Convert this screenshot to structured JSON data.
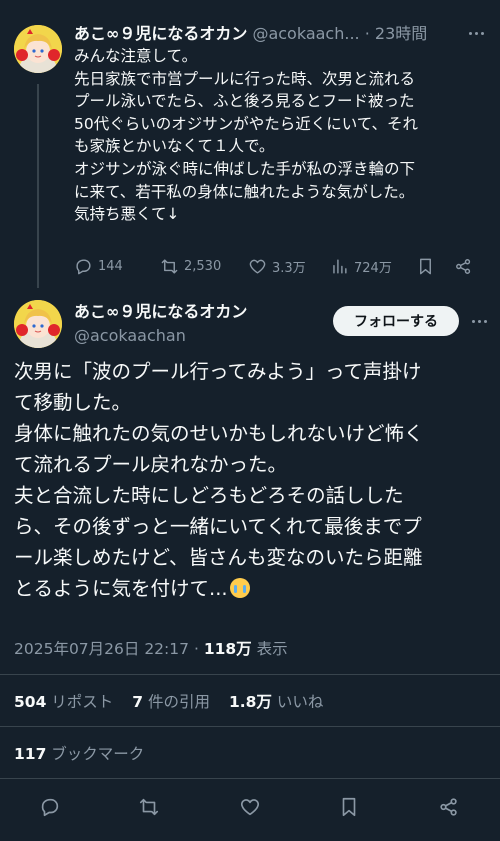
{
  "tweet1": {
    "name": "あこ∞９児になるオカン",
    "handle": "@acokaach...",
    "separator": "·",
    "time": "23時間",
    "lines": [
      "みんな注意して。",
      "先日家族で市営プールに行った時、次男と流れる",
      "プール泳いでたら、ふと後ろ見るとフード被った",
      "50代ぐらいのオジサンがやたら近くにいて、それ",
      "も家族とかいなくて１人で。",
      "オジサンが泳ぐ時に伸ばした手が私の浮き輪の下",
      "に来て、若干私の身体に触れたような気がした。",
      "気持ち悪くて↓"
    ],
    "actions": {
      "replies": "144",
      "reposts": "2,530",
      "likes": "3.3万",
      "views": "724万"
    }
  },
  "tweet2": {
    "name": "あこ∞９児になるオカン",
    "handle": "@acokaachan",
    "follow_label": "フォローする",
    "lines": [
      "次男に「波のプール行ってみよう」って声掛け",
      "て移動した。",
      "身体に触れたの気のせいかもしれないけど怖く",
      "て流れるプール戻れなかった。",
      "夫と合流した時にしどろもどろその話しした",
      "ら、その後ずっと一緒にいてくれて最後までプ",
      "ール楽しめたけど、皆さんも変なのいたら距離",
      "とるように気を付けて..."
    ],
    "emoji": "loudly-crying-face",
    "timestamp": "2025年07月26日 22:17",
    "meta_separator": "·",
    "views_count": "118万",
    "views_label": "表示",
    "reposts_count": "504",
    "reposts_label": "リポスト",
    "quotes_count": "7",
    "quotes_label": "件の引用",
    "likes_count": "1.8万",
    "likes_label": "いいね",
    "bookmarks_count": "117",
    "bookmarks_label": "ブックマーク"
  },
  "colors": {
    "background": "#15202b",
    "text": "#f7f9f9",
    "muted": "#8b98a5",
    "divider": "#38444d",
    "follow_button": "#eff3f4"
  }
}
